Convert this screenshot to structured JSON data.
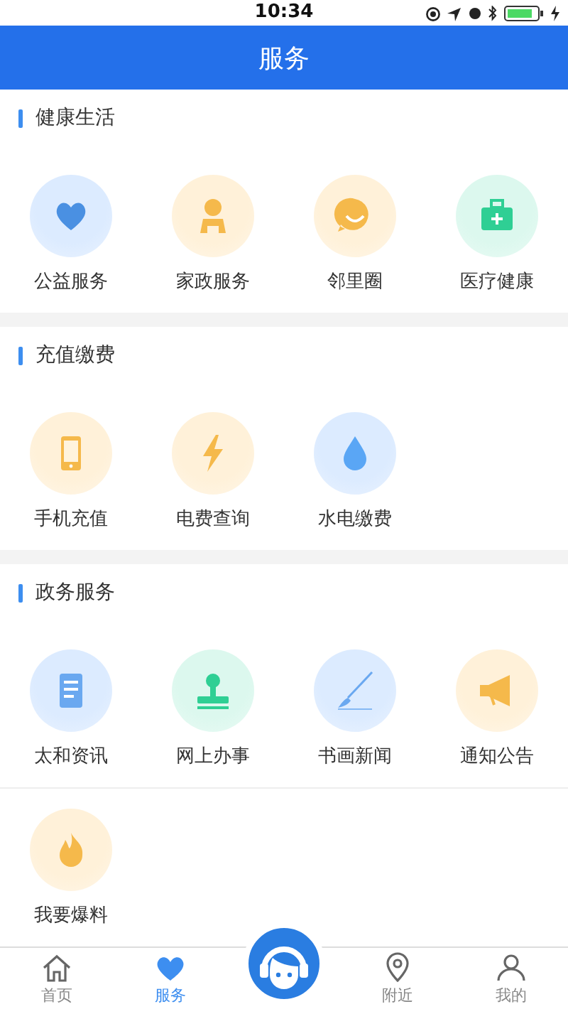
{
  "status_bar": {
    "time": "10:34"
  },
  "header": {
    "title": "服务"
  },
  "sections": [
    {
      "title": "健康生活",
      "items": [
        {
          "label": "公益服务"
        },
        {
          "label": "家政服务"
        },
        {
          "label": "邻里圈"
        },
        {
          "label": "医疗健康"
        }
      ]
    },
    {
      "title": "充值缴费",
      "items": [
        {
          "label": "手机充值"
        },
        {
          "label": "电费查询"
        },
        {
          "label": "水电缴费"
        }
      ]
    },
    {
      "title": "政务服务",
      "items": [
        {
          "label": "太和资讯"
        },
        {
          "label": "网上办事"
        },
        {
          "label": "书画新闻"
        },
        {
          "label": "通知公告"
        },
        {
          "label": "我要爆料"
        }
      ]
    }
  ],
  "tab_bar": [
    {
      "label": "首页",
      "selected": false
    },
    {
      "label": "服务",
      "selected": true
    },
    {
      "label": "附近",
      "selected": false
    },
    {
      "label": "我的",
      "selected": false
    }
  ]
}
